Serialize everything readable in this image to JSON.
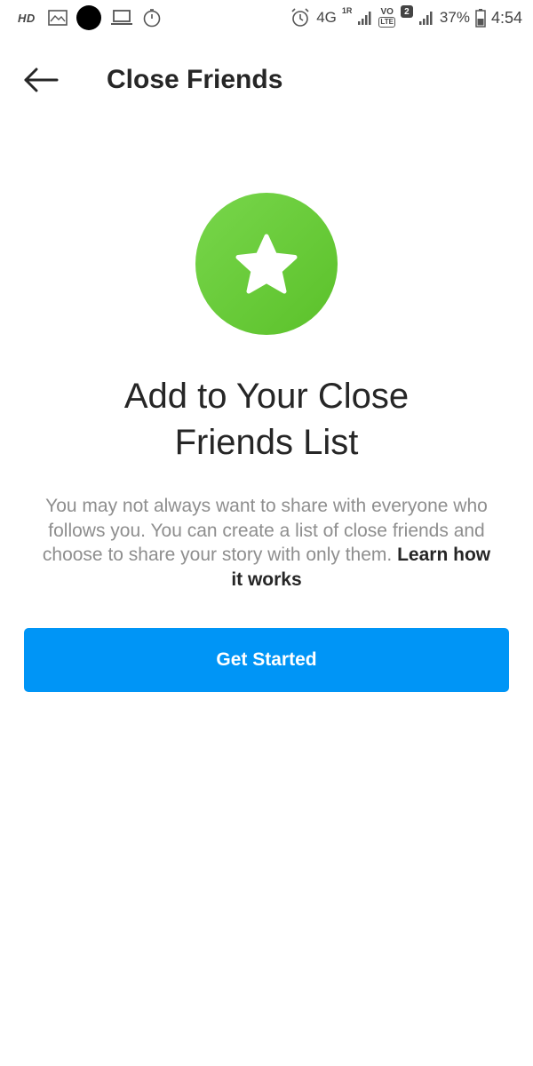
{
  "status_bar": {
    "hd_label": "HD",
    "network_label": "4G",
    "roaming_label": "1R",
    "volte_label": "VO",
    "lte_label": "LTE",
    "sim_badge": "2",
    "battery_percent": "37%",
    "time": "4:54",
    "icons": [
      "gallery-icon",
      "recording-dot-icon",
      "laptop-icon",
      "stopwatch-icon",
      "alarm-icon",
      "signal-icon",
      "battery-icon"
    ]
  },
  "header": {
    "back_icon": "back-arrow-icon",
    "title": "Close Friends"
  },
  "hero": {
    "icon": "star-icon",
    "icon_color": "#5bc12a",
    "heading_line1": "Add to Your Close",
    "heading_line2": "Friends List",
    "description": "You may not always want to share with everyone who follows you. You can create a list of close friends and choose to share your story with only them.",
    "learn_link": "Learn how it works"
  },
  "cta": {
    "label": "Get Started",
    "color": "#0095f6"
  }
}
